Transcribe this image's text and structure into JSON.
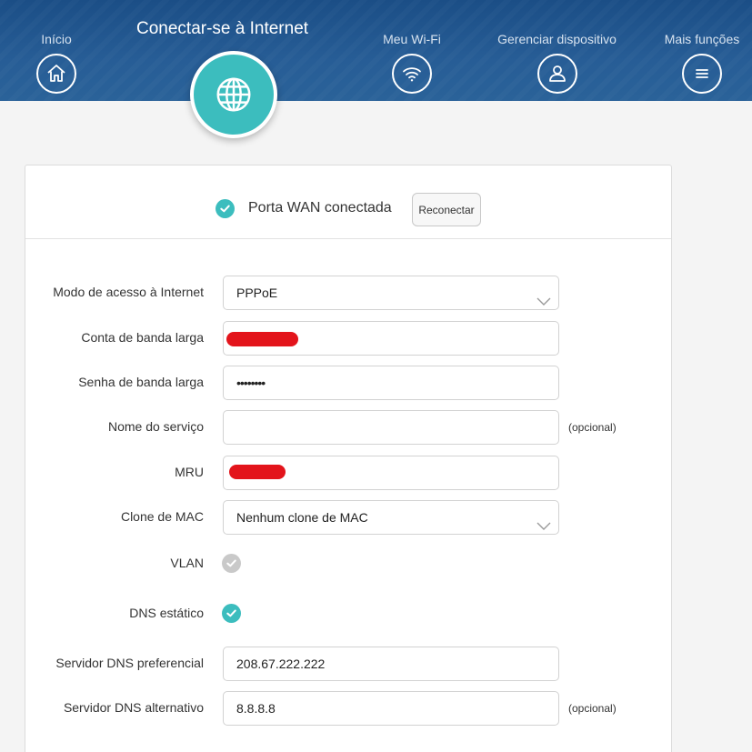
{
  "nav": {
    "items": [
      {
        "label": "Início",
        "icon": "home-icon"
      },
      {
        "label": "Meu Wi-Fi",
        "icon": "wifi-icon"
      },
      {
        "label": "Gerenciar dispositivo",
        "icon": "user-icon"
      },
      {
        "label": "Mais funções",
        "icon": "menu-icon"
      }
    ],
    "active": {
      "label": "Conectar-se à Internet",
      "icon": "globe-icon"
    }
  },
  "status": {
    "text": "Porta WAN conectada",
    "reconnect_label": "Reconectar"
  },
  "form": {
    "access_mode": {
      "label": "Modo de acesso à Internet",
      "value": "PPPoE"
    },
    "account": {
      "label": "Conta de banda larga",
      "value": ""
    },
    "password": {
      "label": "Senha de banda larga",
      "value": "••••••••"
    },
    "service_name": {
      "label": "Nome do serviço",
      "value": "",
      "hint": "(opcional)"
    },
    "mru": {
      "label": "MRU",
      "value": ""
    },
    "mac_clone": {
      "label": "Clone de MAC",
      "value": "Nenhum clone de MAC"
    },
    "vlan": {
      "label": "VLAN",
      "checked": false
    },
    "static_dns": {
      "label": "DNS estático",
      "checked": true
    },
    "dns_primary": {
      "label": "Servidor DNS preferencial",
      "value": "208.67.222.222"
    },
    "dns_secondary": {
      "label": "Servidor DNS alternativo",
      "value": "8.8.8.8",
      "hint": "(opcional)"
    }
  },
  "colors": {
    "header": "#1e5289",
    "accent": "#3cbdbe",
    "redaction": "#e3141b"
  }
}
